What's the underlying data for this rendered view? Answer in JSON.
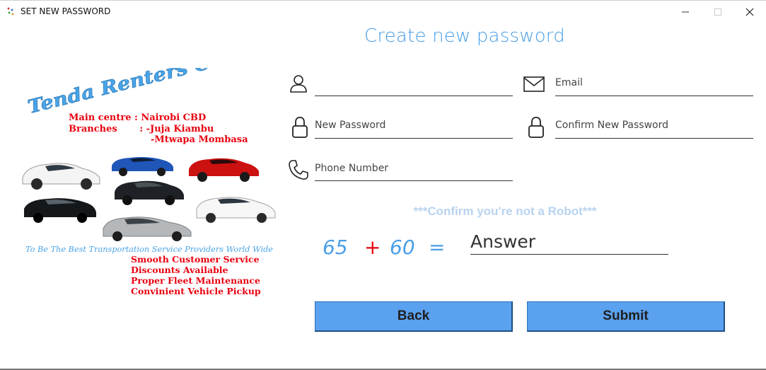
{
  "window": {
    "title": "SET NEW PASSWORD",
    "controls": [
      "minimize-icon",
      "maximize-icon",
      "close-icon"
    ]
  },
  "heading": "Create new password",
  "banner": {
    "company": "Tenda Renters CO.LTD",
    "main_centre": "Main centre : Nairobi CBD",
    "branches": "Branches       : -Juja Kiambu",
    "branches_2": "-Mtwapa Mombasa",
    "slogan": "To Be The Best Transportation Service Providers World Wide",
    "features": [
      "Smooth Customer Service",
      "Discounts Available",
      "Proper Fleet Maintenance",
      "Convinient Vehicle Pickup"
    ],
    "colors": {
      "company": "#4aa4e8",
      "main": "#e8000f",
      "slogan": "#4aa4e8"
    }
  },
  "form": {
    "username": {
      "label": "",
      "icon": "user-icon"
    },
    "email": {
      "label": "Email",
      "icon": "mail-icon"
    },
    "new_password": {
      "label": "New Password",
      "icon": "lock-icon"
    },
    "confirm_password": {
      "label": "Confirm New Password",
      "icon": "lock-icon"
    },
    "phone": {
      "label": "Phone Number",
      "icon": "phone-icon"
    }
  },
  "captcha": {
    "prompt": "***Confirm you're not a Robot***",
    "a": "65",
    "op": "+",
    "b": "60",
    "eq": "=",
    "answer_placeholder": "Answer"
  },
  "buttons": {
    "back": "Back",
    "submit": "Submit"
  },
  "colors": {
    "accent": "#4a9ee6",
    "button": "#5aa1f0"
  }
}
